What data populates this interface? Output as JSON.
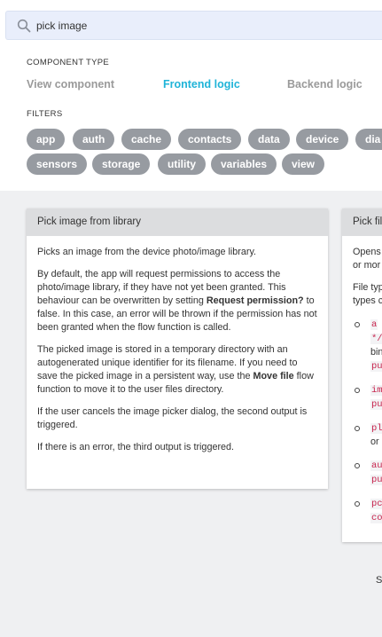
{
  "search": {
    "value": "pick image",
    "icon": "search-icon"
  },
  "component_type": {
    "label": "COMPONENT TYPE",
    "options": [
      "View component",
      "Frontend logic",
      "Backend logic"
    ],
    "active_index": 1
  },
  "filters": {
    "label": "FILTERS",
    "chips": [
      "app",
      "auth",
      "cache",
      "contacts",
      "data",
      "device",
      "dia",
      "sensors",
      "storage",
      "utility",
      "variables",
      "view"
    ]
  },
  "card1": {
    "title": "Pick image from library",
    "p1": "Picks an image from the device photo/image library.",
    "p2_a": "By default, the app will request permissions to access the photo/image library, if they have not yet been granted. This behaviour can be overwritten by setting ",
    "p2_b": "Request permission?",
    "p2_c": " to false. In this case, an error will be thrown if the permission has not been granted when the flow function is called.",
    "p3_a": "The picked image is stored in a temporary directory with an autogenerated unique identifier for its filename. If you need to save the picked image in a persistent way, use the ",
    "p3_b": "Move file",
    "p3_c": " flow function to move it to the user files directory.",
    "p4": "If the user cancels the image picker dialog, the second output is triggered.",
    "p5": "If there is an error, the third output is triggered."
  },
  "card2": {
    "title": "Pick fil",
    "line1": "Opens",
    "line2": "or mor",
    "line3": "File typ",
    "line4": "types c",
    "bullets": [
      {
        "code1": "a",
        "code2": "*/",
        "text1": "bin",
        "text2": "pu"
      },
      {
        "code1": "im",
        "text1": "pu"
      },
      {
        "code1": "pl",
        "text1": "or"
      },
      {
        "code1": "au",
        "text1": "pu"
      },
      {
        "code1": "pc",
        "text1": "co"
      }
    ]
  },
  "footer_fragment": "S"
}
